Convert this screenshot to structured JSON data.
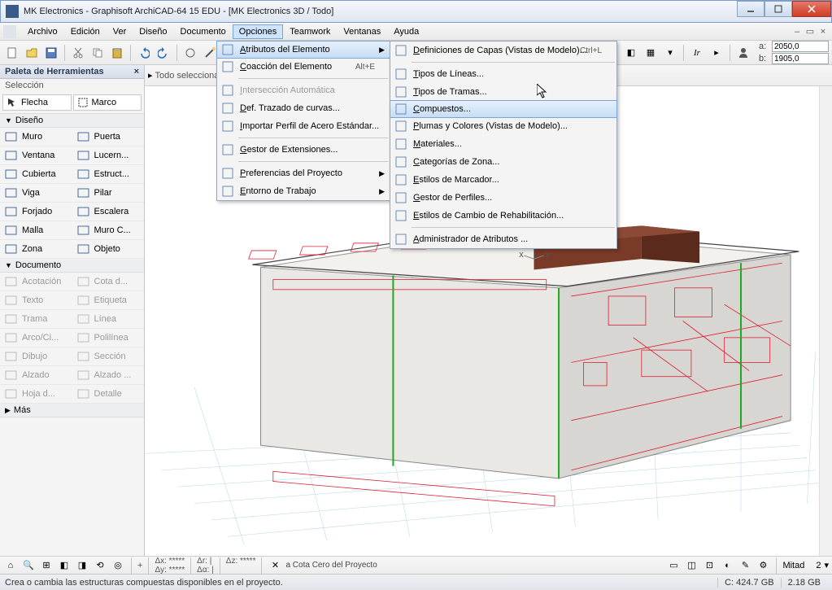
{
  "title": "MK Electronics - Graphisoft ArchiCAD-64 15 EDU - [MK Electronics 3D / Todo]",
  "menus": [
    "Archivo",
    "Edición",
    "Ver",
    "Diseño",
    "Documento",
    "Opciones",
    "Teamwork",
    "Ventanas",
    "Ayuda"
  ],
  "open_menu_index": 5,
  "dd1": {
    "items": [
      {
        "label": "Atributos del Elemento",
        "arrow": true,
        "hover": true
      },
      {
        "label": "Coacción del Elemento",
        "accel": "Alt+E"
      },
      {
        "label": "Intersección Automática",
        "disabled": true
      },
      {
        "label": "Def. Trazado de curvas..."
      },
      {
        "label": "Importar Perfil de Acero Estándar..."
      },
      {
        "label": "Gestor de Extensiones..."
      },
      {
        "label": "Preferencias del Proyecto",
        "arrow": true
      },
      {
        "label": "Entorno de Trabajo",
        "arrow": true
      }
    ],
    "seps": [
      2,
      5,
      6
    ]
  },
  "dd2": {
    "items": [
      {
        "label": "Definiciones de Capas (Vistas de Modelo)...",
        "accel": "Ctrl+L"
      },
      {
        "label": "Tipos de Líneas..."
      },
      {
        "label": "Tipos de Tramas..."
      },
      {
        "label": "Compuestos...",
        "hover": true
      },
      {
        "label": "Plumas y Colores (Vistas de Modelo)..."
      },
      {
        "label": "Materiales..."
      },
      {
        "label": "Categorías de Zona..."
      },
      {
        "label": "Estilos de Marcador..."
      },
      {
        "label": "Gestor de Perfiles..."
      },
      {
        "label": "Estilos de Cambio de Rehabilitación..."
      },
      {
        "label": "Administrador de Atributos ..."
      }
    ],
    "seps": [
      1,
      10
    ]
  },
  "palette_title": "Paleta de Herramientas",
  "selection_header": "Selección",
  "sel_buttons": [
    "Flecha",
    "Marco"
  ],
  "groups": [
    {
      "name": "Diseño",
      "items": [
        [
          "Muro",
          "Puerta"
        ],
        [
          "Ventana",
          "Lucern..."
        ],
        [
          "Cubierta",
          "Estruct..."
        ],
        [
          "Viga",
          "Pilar"
        ],
        [
          "Forjado",
          "Escalera"
        ],
        [
          "Malla",
          "Muro C..."
        ],
        [
          "Zona",
          "Objeto"
        ]
      ]
    },
    {
      "name": "Documento",
      "disabled": true,
      "items": [
        [
          "Acotación",
          "Cota d..."
        ],
        [
          "Texto",
          "Etiqueta"
        ],
        [
          "Trama",
          "Línea"
        ],
        [
          "Arco/Ci...",
          "Polilínea"
        ],
        [
          "Dibujo",
          "Sección"
        ],
        [
          "Alzado",
          "Alzado ..."
        ],
        [
          "Hoja d...",
          "Detalle"
        ]
      ]
    },
    {
      "name": "Más"
    }
  ],
  "infobar_label": "Todo seleccionado:",
  "coord_a": "2050,0",
  "coord_b": "1905,0",
  "bottom_text": "a Cota Cero del Proyecto",
  "scale_label": "Mitad",
  "zoom": "2",
  "status_text": "Crea o cambia las estructuras compuestas disponibles en el proyecto.",
  "disk_c": "C: 424.7 GB",
  "disk_free": "2.18 GB"
}
